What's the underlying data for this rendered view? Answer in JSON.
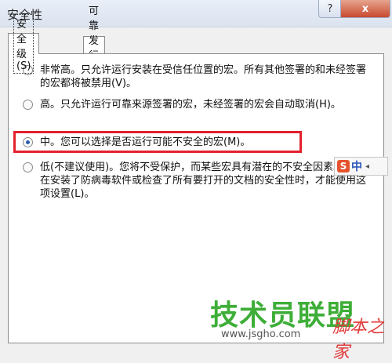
{
  "window": {
    "title": "安全性",
    "help_label": "?",
    "close_label": "x"
  },
  "tabs": [
    {
      "label": "安全级(S)"
    },
    {
      "label": "可靠发行商(I)"
    }
  ],
  "options": [
    {
      "text": "非常高。只允许运行安装在受信任位置的宏。所有其他签署的和未经签署的宏都将被禁用(V)。",
      "selected": false
    },
    {
      "text": "高。只允许运行可靠来源签署的宏，未经签署的宏会自动取消(H)。",
      "selected": false
    },
    {
      "text": "中。您可以选择是否运行可能不安全的宏(M)。",
      "selected": true
    },
    {
      "text": "低(不建议使用)。您将不受保护，而某些宏具有潜在的不安全因素。只有在安装了防病毒软件或检查了所有要打开的文档的安全性时，才能使用这项设置(L)。",
      "selected": false
    }
  ],
  "ime": {
    "logo": "S",
    "label": "中",
    "arrow": "◂"
  },
  "watermark": {
    "main": "技术员联盟",
    "side": "脚本之家",
    "url": "www.jsgho.com"
  },
  "colors": {
    "highlight": "#e3212d",
    "watermark_green": "#3eae38",
    "ime_orange": "#e5532d"
  }
}
